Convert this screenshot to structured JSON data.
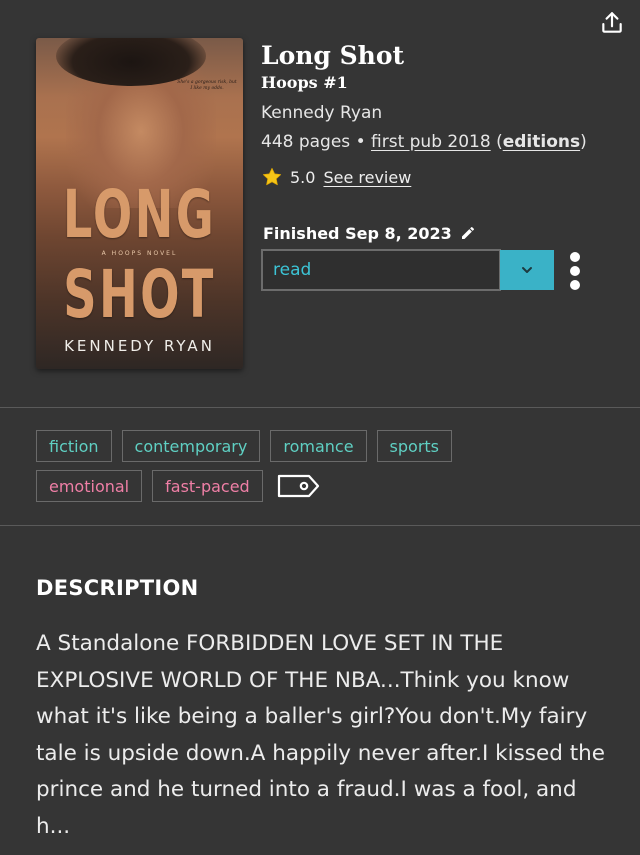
{
  "header": {
    "share_icon": "share-upload-icon"
  },
  "book": {
    "cover": {
      "title_line1": "LONG",
      "title_line2": "SHOT",
      "series_line": "A HOOPS NOVEL",
      "quote": "She's a gorgeous risk, but I like my odds.",
      "author": "KENNEDY RYAN"
    },
    "title": "Long Shot",
    "series": "Hoops #1",
    "author": "Kennedy Ryan",
    "pages": "448 pages",
    "separator": "•",
    "first_pub": "first pub 2018",
    "editions_open": "(",
    "editions_label": "editions",
    "editions_close": ")",
    "rating": "5.0",
    "see_review": "See review",
    "finished": "Finished Sep 8, 2023",
    "status": "read"
  },
  "tags": {
    "row1": [
      "fiction",
      "contemporary",
      "romance",
      "sports"
    ],
    "row2": [
      "emotional",
      "fast-paced"
    ]
  },
  "description": {
    "heading": "DESCRIPTION",
    "text": "A Standalone FORBIDDEN LOVE SET IN THE EXPLOSIVE WORLD OF THE NBA...Think you know what it's like being a baller's girl?You don't.My fairy tale is upside down.A happily never after.I kissed the prince and he turned into a fraud.I was a fool, and h..."
  },
  "colors": {
    "background": "#353535",
    "accent_teal": "#3ab2c7",
    "tag_teal": "#5fd0c3",
    "tag_pink": "#ef7fa6",
    "star": "#f5c518"
  }
}
